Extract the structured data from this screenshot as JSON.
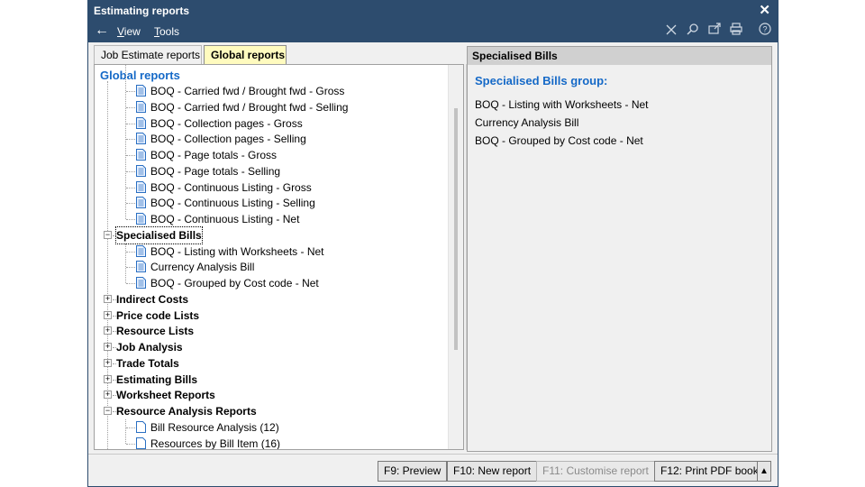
{
  "window": {
    "title": "Estimating reports",
    "close_glyph": "✕"
  },
  "menubar": {
    "back_icon": "←",
    "menus": [
      "View",
      "Tools"
    ],
    "toolbar_icons": [
      "close-x-icon",
      "search-icon",
      "export-icon",
      "print-icon",
      "help-icon"
    ]
  },
  "tabs": [
    {
      "label": "Job Estimate reports",
      "active": false
    },
    {
      "label": "Global reports",
      "active": true
    }
  ],
  "tree": {
    "root": "Global reports",
    "nodes": [
      {
        "label": "BOQ - Carried fwd / Brought fwd - Gross",
        "type": "report"
      },
      {
        "label": "BOQ - Carried fwd / Brought fwd - Selling",
        "type": "report"
      },
      {
        "label": "BOQ - Collection pages - Gross",
        "type": "report"
      },
      {
        "label": "BOQ - Collection pages - Selling",
        "type": "report"
      },
      {
        "label": "BOQ - Page totals - Gross",
        "type": "report"
      },
      {
        "label": "BOQ - Page totals - Selling",
        "type": "report"
      },
      {
        "label": "BOQ - Continuous Listing - Gross",
        "type": "report"
      },
      {
        "label": "BOQ - Continuous Listing - Selling",
        "type": "report"
      },
      {
        "label": "BOQ - Continuous Listing - Net",
        "type": "report"
      },
      {
        "label": "Specialised Bills",
        "type": "group",
        "expanded": true,
        "focused": true
      },
      {
        "label": "BOQ - Listing with Worksheets - Net",
        "type": "report"
      },
      {
        "label": "Currency Analysis Bill",
        "type": "report"
      },
      {
        "label": "BOQ - Grouped by Cost code - Net",
        "type": "report"
      },
      {
        "label": "Indirect Costs",
        "type": "group",
        "expanded": false
      },
      {
        "label": "Price code Lists",
        "type": "group",
        "expanded": false
      },
      {
        "label": "Resource Lists",
        "type": "group",
        "expanded": false
      },
      {
        "label": "Job Analysis",
        "type": "group",
        "expanded": false
      },
      {
        "label": "Trade Totals",
        "type": "group",
        "expanded": false
      },
      {
        "label": "Estimating Bills",
        "type": "group",
        "expanded": false
      },
      {
        "label": "Worksheet Reports",
        "type": "group",
        "expanded": false
      },
      {
        "label": "Resource Analysis Reports",
        "type": "group",
        "expanded": true
      },
      {
        "label": "Bill Resource Analysis (12)",
        "type": "blank"
      },
      {
        "label": "Resources by Bill Item (16)",
        "type": "blank"
      }
    ]
  },
  "detail": {
    "header": "Specialised Bills",
    "group_title": "Specialised Bills group:",
    "items": [
      "BOQ - Listing with Worksheets - Net",
      "Currency Analysis Bill",
      "BOQ - Grouped by Cost code - Net"
    ]
  },
  "footer": {
    "preview": "F9: Preview",
    "new_report": "F10: New report",
    "customise": "F11: Customise report",
    "print_pdf": "F12: Print PDF book",
    "up_glyph": "▲"
  },
  "colors": {
    "titlebar": "#2d4c6e",
    "accent": "#1569c7",
    "active_tab": "#fffbbf"
  }
}
